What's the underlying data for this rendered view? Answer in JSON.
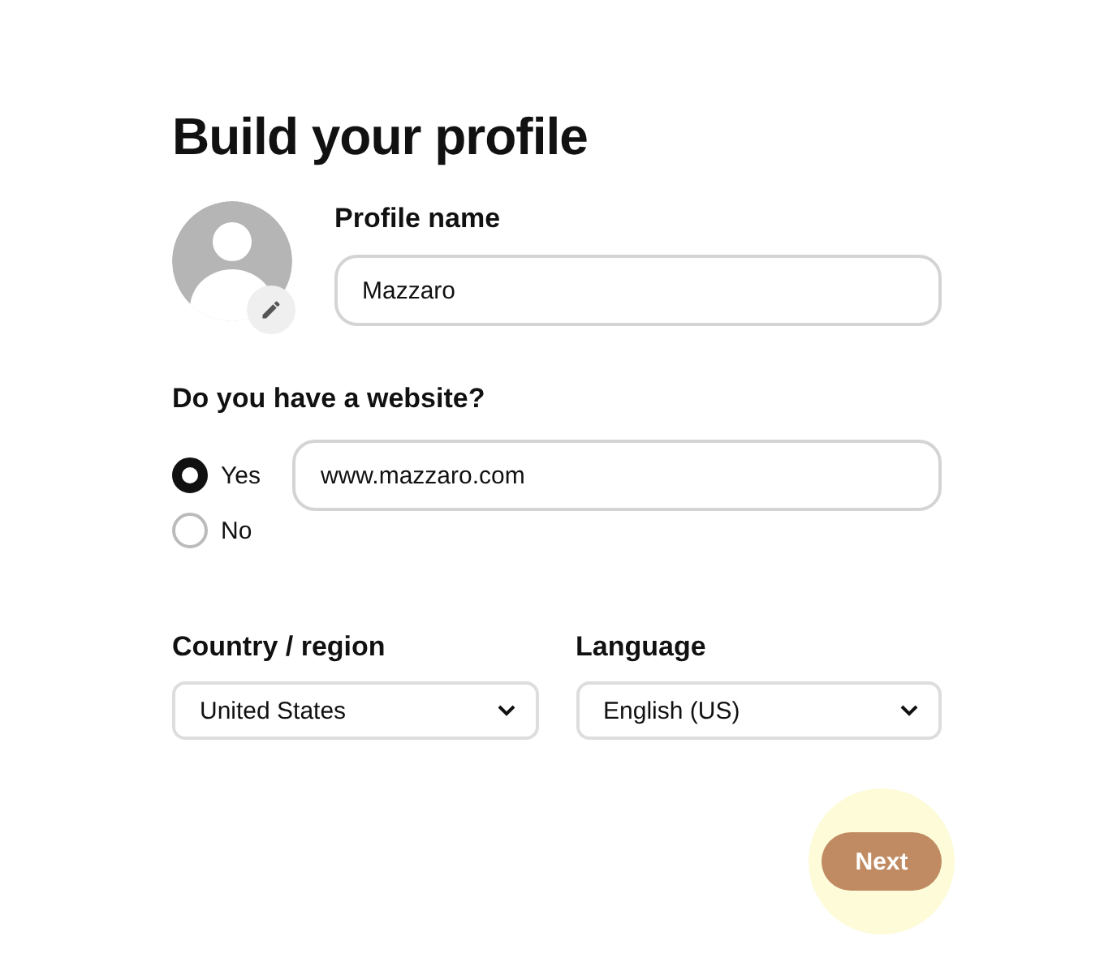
{
  "title": "Build your profile",
  "profile_name": {
    "label": "Profile name",
    "value": "Mazzaro"
  },
  "website": {
    "question": "Do you have a website?",
    "options": [
      {
        "label": "Yes",
        "selected": true
      },
      {
        "label": "No",
        "selected": false
      }
    ],
    "value": "www.mazzaro.com"
  },
  "selects": [
    {
      "label": "Country / region",
      "value": "United States"
    },
    {
      "label": "Language",
      "value": "English (US)"
    }
  ],
  "next_button": {
    "label": "Next",
    "highlighted": true
  }
}
